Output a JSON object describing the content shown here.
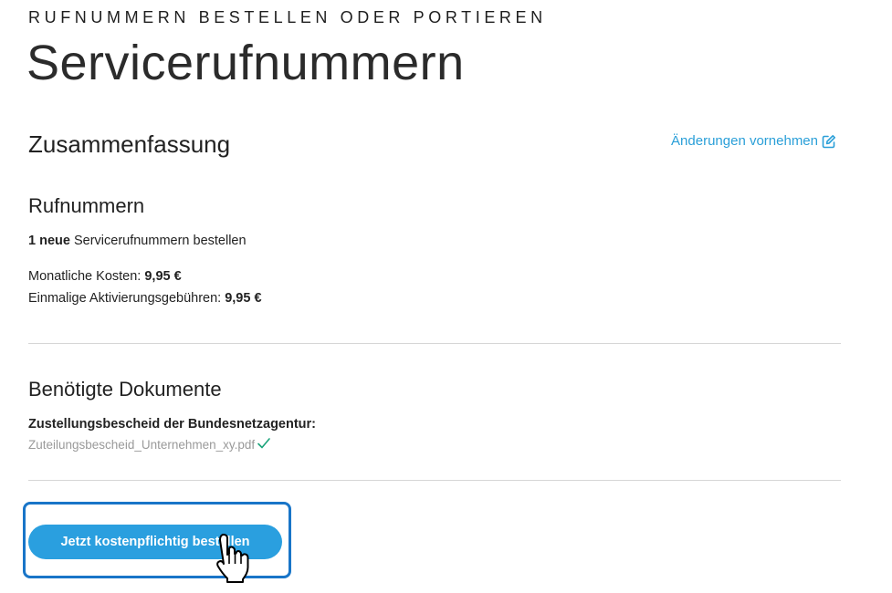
{
  "header": {
    "eyebrow": "RUFNUMMERN BESTELLEN ODER PORTIEREN",
    "title": "Servicerufnummern"
  },
  "summary": {
    "title": "Zusammenfassung",
    "edit_link": "Änderungen vornehmen",
    "edit_icon": "edit-icon"
  },
  "numbers": {
    "title": "Rufnummern",
    "order_count": "1 neue",
    "order_text": " Servicerufnummern bestellen",
    "monthly_label": "Monatliche Kosten: ",
    "monthly_value": "9,95 €",
    "activation_label": "Einmalige Aktivierungsgebühren: ",
    "activation_value": "9,95 €"
  },
  "documents": {
    "title": "Benötigte Dokumente",
    "required_label": "Zustellungsbescheid der Bundesnetzagentur:",
    "file_name": "Zuteilungsbescheid_Unternehmen_xy.pdf",
    "file_status_icon": "checkmark-icon"
  },
  "actions": {
    "order_button": "Jetzt kostenpflichtig bestellen"
  },
  "colors": {
    "accent": "#2a9fdf",
    "link": "#2a9fd8",
    "highlight_border": "#1975c8",
    "check": "#1aa37a"
  },
  "cursor": "hand-pointer-icon"
}
